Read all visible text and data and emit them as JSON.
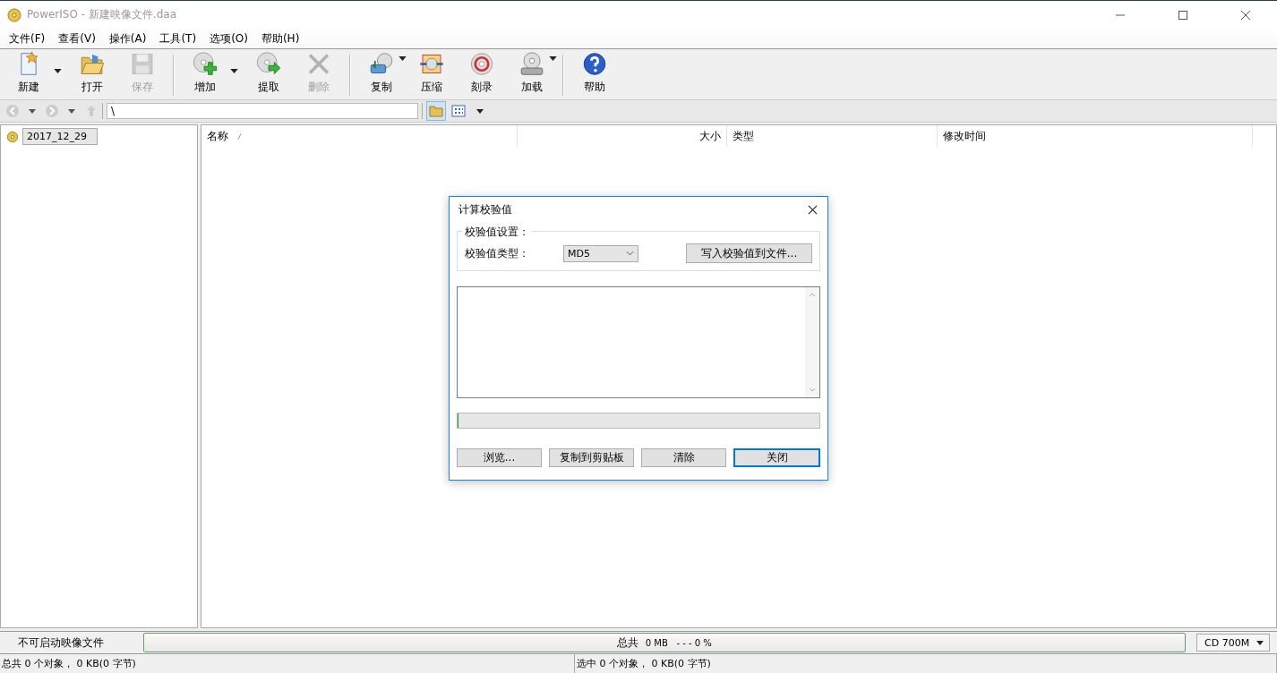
{
  "window": {
    "title": "PowerISO - 新建映像文件.daa"
  },
  "menu": [
    "文件(F)",
    "查看(V)",
    "操作(A)",
    "工具(T)",
    "选项(O)",
    "帮助(H)"
  ],
  "toolbar": [
    [
      {
        "kind": "new",
        "label": "新建",
        "disabled": false,
        "dropdown": true
      },
      {
        "kind": "open",
        "label": "打开",
        "disabled": false,
        "dropdown": false
      },
      {
        "kind": "save",
        "label": "保存",
        "disabled": true,
        "dropdown": false
      }
    ],
    [
      {
        "kind": "add",
        "label": "增加",
        "disabled": false,
        "dropdown": true
      },
      {
        "kind": "extract",
        "label": "提取",
        "disabled": false,
        "dropdown": false
      },
      {
        "kind": "delete",
        "label": "删除",
        "disabled": true,
        "dropdown": false
      }
    ],
    [
      {
        "kind": "copy",
        "label": "复制",
        "disabled": false,
        "dropdown": true
      },
      {
        "kind": "compress",
        "label": "压缩",
        "disabled": false,
        "dropdown": false
      },
      {
        "kind": "burn",
        "label": "刻录",
        "disabled": false,
        "dropdown": false
      },
      {
        "kind": "mount",
        "label": "加载",
        "disabled": false,
        "dropdown": true
      }
    ],
    [
      {
        "kind": "help",
        "label": "帮助",
        "disabled": false,
        "dropdown": false
      }
    ]
  ],
  "address": {
    "value": "\\"
  },
  "tree": [
    {
      "label": "2017_12_29",
      "selected": true
    }
  ],
  "table": {
    "columns": [
      {
        "label": "名称",
        "sorted": true
      },
      {
        "label": "大小",
        "sorted": false
      },
      {
        "label": "类型",
        "sorted": false
      },
      {
        "label": "修改时间",
        "sorted": false
      }
    ]
  },
  "dialog": {
    "title": "计算校验值",
    "group_label": "校验值设置：",
    "type_label": "校验值类型：",
    "type_value": "MD5",
    "write_button": "写入校验值到文件...",
    "progress": {
      "level": 0
    },
    "buttons": [
      {
        "label": "浏览...",
        "default": false
      },
      {
        "label": "复制到剪贴板",
        "default": false
      },
      {
        "label": "清除",
        "default": false
      },
      {
        "label": "关闭",
        "default": true
      }
    ]
  },
  "status_bar": {
    "boot_info": "不可启动映像文件",
    "total_label": "总共",
    "total_size": "0 MB",
    "total_percent": "- - -  0 %",
    "media": "CD 700M"
  },
  "footer": [
    "总共 0 个对象， 0 KB(0 字节)",
    "选中 0 个对象， 0 KB(0 字节)"
  ]
}
